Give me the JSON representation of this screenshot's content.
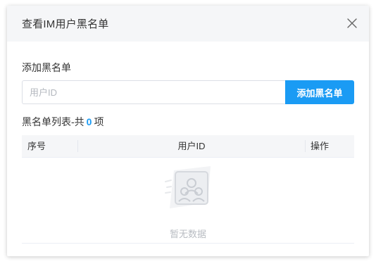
{
  "dialog": {
    "title": "查看IM用户黑名单",
    "close_icon": "close-icon"
  },
  "add_section": {
    "label": "添加黑名单",
    "input_placeholder": "用户ID",
    "input_value": "",
    "button_label": "添加黑名单"
  },
  "list": {
    "heading_prefix": "黑名单列表-共",
    "count": "0",
    "heading_suffix": "项",
    "columns": [
      "序号",
      "用户ID",
      "操作"
    ],
    "rows": [],
    "empty_text": "暂无数据",
    "empty_icon": "users-empty-icon"
  },
  "colors": {
    "accent": "#1a9bf4",
    "header_bg": "#f5f6f8"
  }
}
